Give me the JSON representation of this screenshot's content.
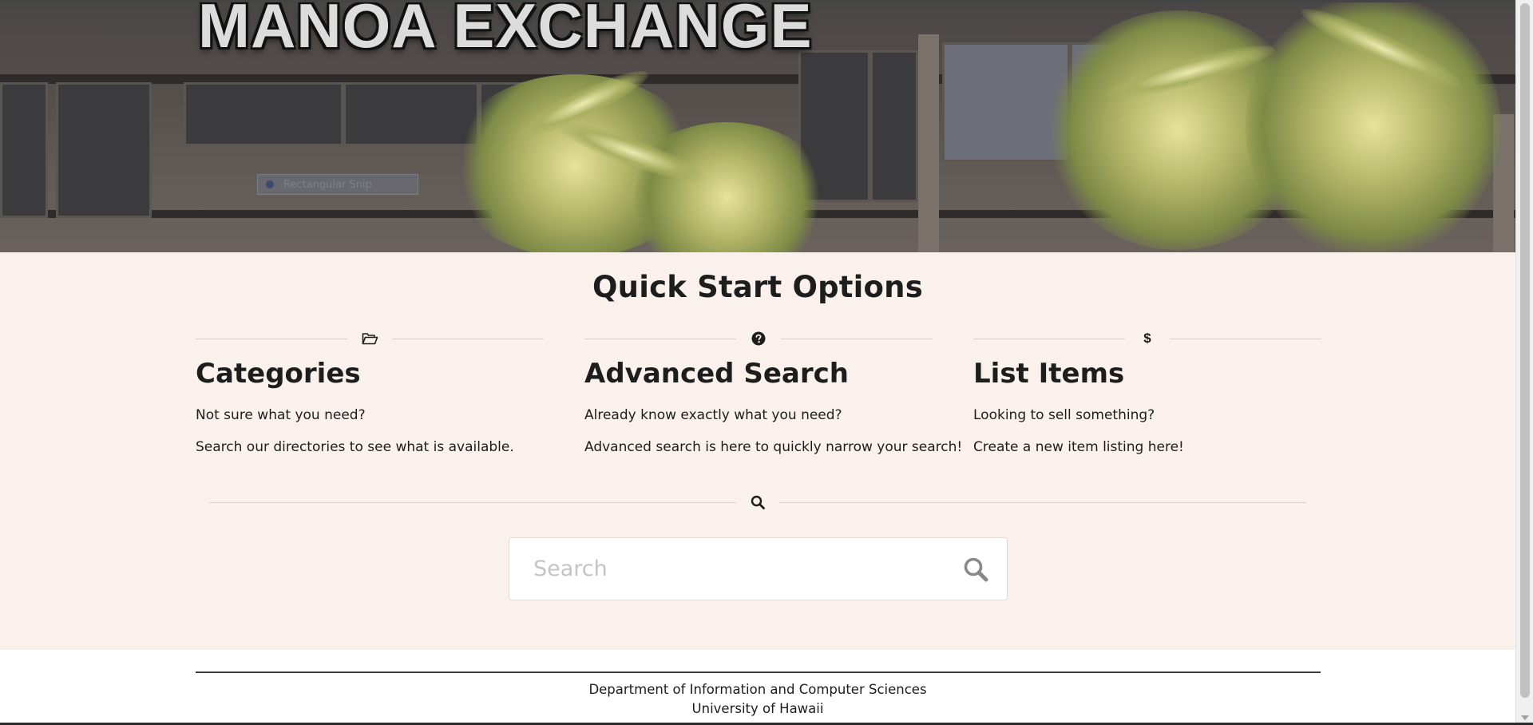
{
  "hero": {
    "title": "MANOA EXCHANGE",
    "snip_label": "Rectangular Snip"
  },
  "quick_start": {
    "title": "Quick Start Options",
    "columns": [
      {
        "icon": "folder-open-icon",
        "title": "Categories",
        "line1": "Not sure what you need?",
        "line2": "Search our directories to see what is available."
      },
      {
        "icon": "question-circle-icon",
        "title": "Advanced Search",
        "line1": "Already know exactly what you need?",
        "line2": "Advanced search is here to quickly narrow your search!"
      },
      {
        "icon": "dollar-icon",
        "title": "List Items",
        "line1": "Looking to sell something?",
        "line2": "Create a new item listing here!"
      }
    ],
    "dollar_glyph": "$"
  },
  "search": {
    "divider_icon": "search-icon",
    "placeholder": "Search",
    "value": "",
    "button_icon": "search-icon"
  },
  "footer": {
    "line1": "Department of Information and Computer Sciences",
    "line2": "University of Hawaii"
  },
  "colors": {
    "section_bg": "#faf1ec",
    "text": "#1d1d1d",
    "divider": "#d6d0cc",
    "search_icon": "#888888"
  }
}
